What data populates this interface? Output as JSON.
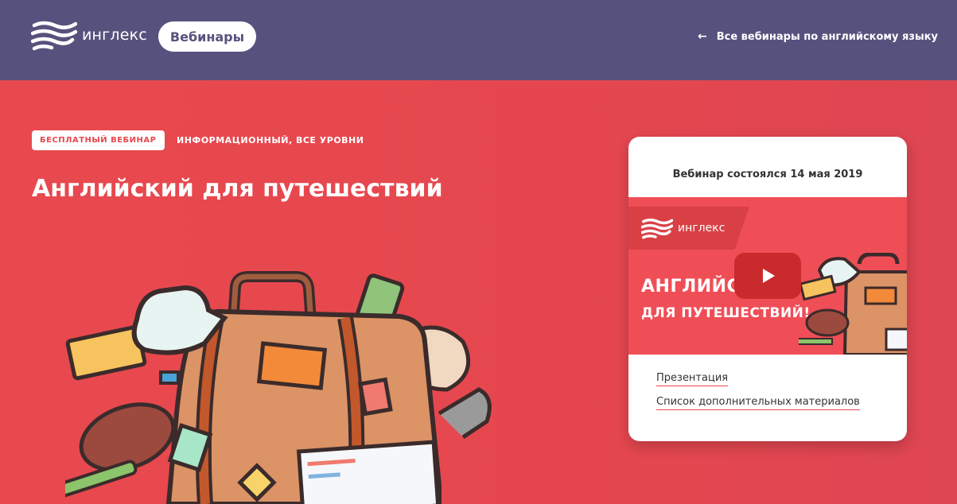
{
  "header": {
    "logo_text": "инглекс",
    "webinars_label": "Вебинары",
    "back_link": "Все вебинары по английскому языку"
  },
  "hero": {
    "badge": "БЕСПЛАТНЫЙ ВЕБИНАР",
    "level": "ИНФОРМАЦИОННЫЙ, ВСЕ УРОВНИ",
    "title": "Английский для путешествий"
  },
  "card": {
    "date_text": "Вебинар состоялся 14 мая 2019",
    "video": {
      "logo_text": "инглекс",
      "title_line1": "АНГЛИЙСК",
      "title_line2": "ДЛЯ ПУТЕШЕСТВИЙ!"
    },
    "links": [
      "Презентация",
      "Список дополнительных материалов"
    ]
  },
  "colors": {
    "header_bg": "#57527d",
    "hero_bg": "#e6484f",
    "accent": "#e6484f"
  }
}
